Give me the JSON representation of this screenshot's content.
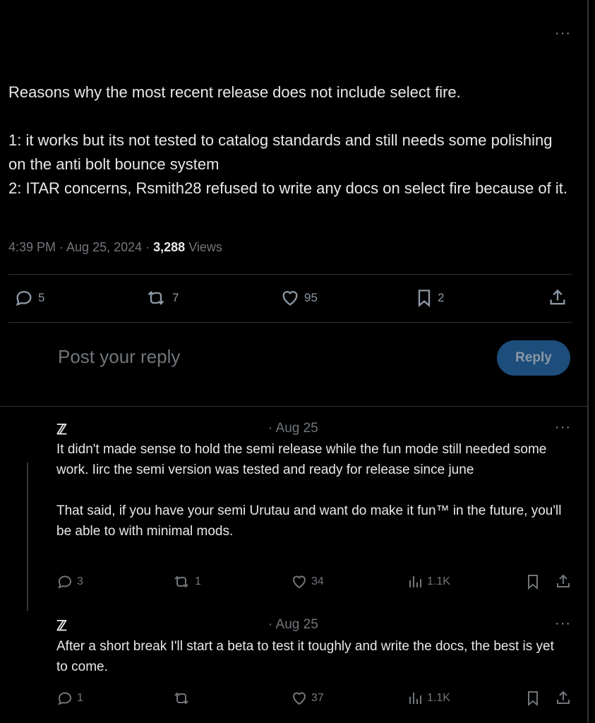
{
  "tweet": {
    "more_label": "···",
    "text": {
      "line1": "Reasons why the most recent release does not include select fire.",
      "line2": "1: it works but its not tested to catalog standards and still needs some polishing on the anti bolt bounce system",
      "line3": "2: ITAR concerns, Rsmith28 refused to write any docs on select fire because of it."
    },
    "time": "4:39 PM · Aug 25, 2024 · ",
    "views_count": "3,288",
    "views_label": " Views",
    "actions": {
      "replies": "5",
      "retweets": "7",
      "likes": "95",
      "bookmarks": "2"
    }
  },
  "reply_composer": {
    "placeholder": "Post your reply",
    "button_label": "Reply"
  },
  "replies": [
    {
      "author": "ℤ",
      "date": "· Aug 25",
      "more_label": "···",
      "text_p1": "It didn't made sense to hold the semi release while the fun mode still needed some work. Iirc the semi version was tested and ready for release since june",
      "text_p2": "That said, if you have your semi Urutau and want do make it fun™ in the future, you'll be able to with minimal mods.",
      "replies": "3",
      "retweets": "1",
      "likes": "34",
      "views": "1.1K"
    },
    {
      "author": "ℤ",
      "date": "· Aug 25",
      "more_label": "···",
      "text_p1": "After a short break I'll start a beta to test it toughly and write the docs, the best is yet to come.",
      "replies": "1",
      "retweets": "",
      "likes": "37",
      "views": "1.1K"
    }
  ],
  "colors": {
    "background": "#000000",
    "text": "#e7e9ea",
    "muted": "#71767b",
    "divider": "#2f3336",
    "reply_button": "#1d4d7a"
  }
}
